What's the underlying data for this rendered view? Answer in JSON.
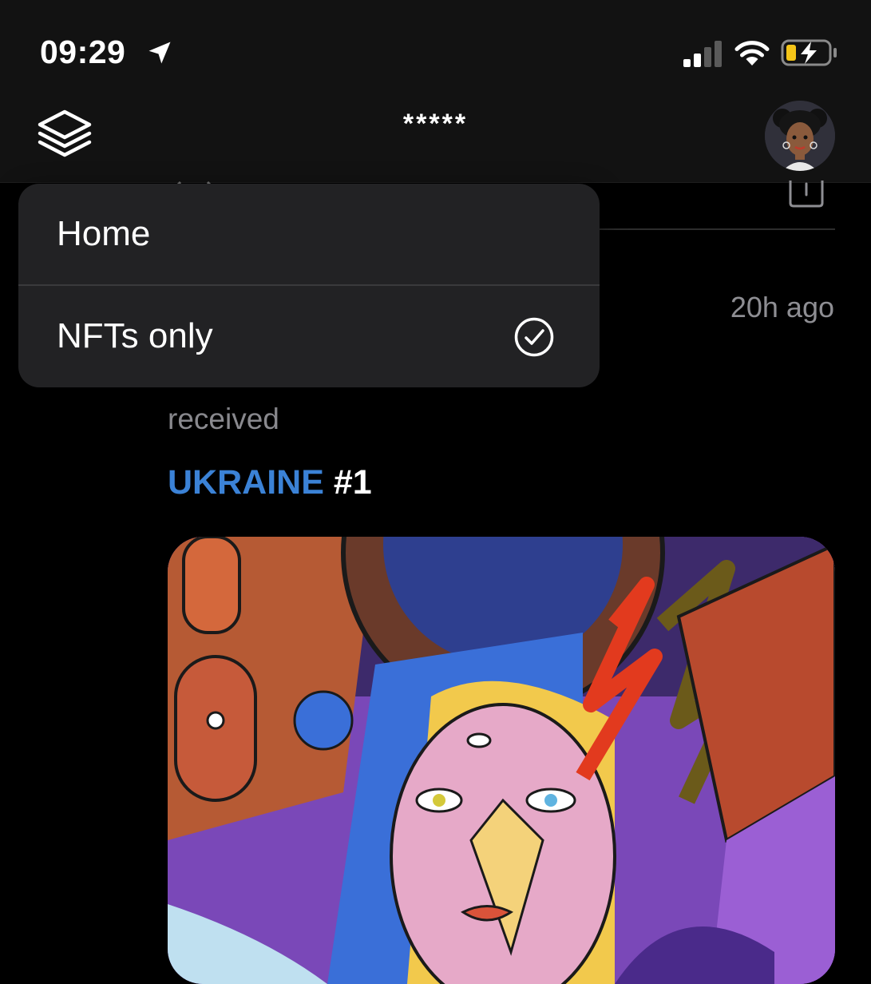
{
  "status_bar": {
    "time": "09:29",
    "icons": [
      "location-arrow-icon",
      "cellular-signal-icon",
      "wifi-icon",
      "battery-charging-icon"
    ],
    "battery_color": "#f5c518"
  },
  "nav": {
    "title": "*****",
    "left_icon": "layers-icon",
    "right_icon": "avatar"
  },
  "feed": {
    "timestamp": "20h ago",
    "action": "received",
    "nft_collection": "UKRAINE",
    "nft_number": "#1",
    "accent_color": "#3b82d6"
  },
  "menu": {
    "items": [
      {
        "label": "Home",
        "selected": false
      },
      {
        "label": "NFTs only",
        "selected": true
      }
    ],
    "check_icon": "checkmark-circle-icon"
  }
}
